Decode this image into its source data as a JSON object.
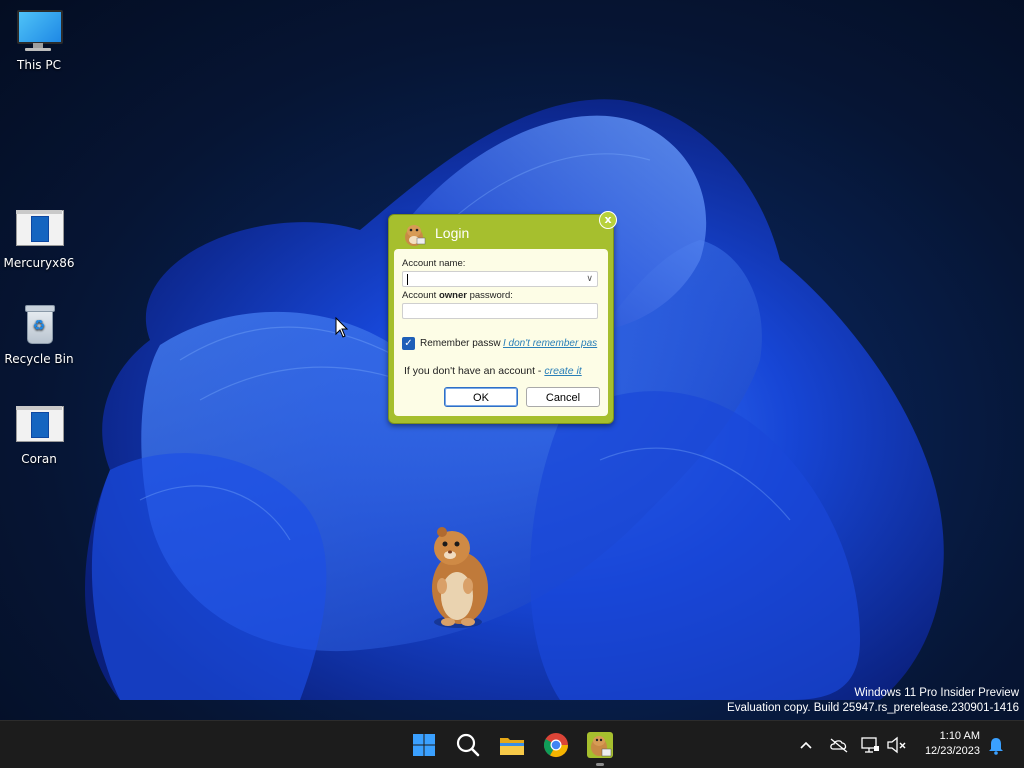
{
  "desktop": {
    "icons": [
      {
        "label": "This PC",
        "icon": "monitor-icon"
      },
      {
        "label": "Mercuryx86",
        "icon": "app-window-icon"
      },
      {
        "label": "Recycle Bin",
        "icon": "recycle-bin-icon"
      },
      {
        "label": "Coran",
        "icon": "app-window-icon"
      }
    ]
  },
  "login_dialog": {
    "title": "Login",
    "close_label": "x",
    "account_name_label": "Account name:",
    "account_name_value": "",
    "password_label_prefix": "Account ",
    "password_label_bold": "owner",
    "password_label_suffix": " password:",
    "password_value": "",
    "remember_label": "Remember passw",
    "remember_checked": true,
    "forgot_link": "I don't remember pas",
    "no_account_text": "If you don't have an account - ",
    "create_link": "create it",
    "ok_label": "OK",
    "cancel_label": "Cancel",
    "accent_color": "#a6bf2e"
  },
  "watermark": {
    "line1": "Windows 11 Pro Insider Preview",
    "line2": "Evaluation copy. Build 25947.rs_prerelease.230901-1416"
  },
  "taskbar": {
    "apps": [
      "windows-start-icon",
      "search-icon",
      "file-explorer-icon",
      "chrome-icon",
      "hamster-app-icon"
    ],
    "tray": [
      "chevron-up-icon",
      "cloud-offline-icon",
      "network-icon",
      "volume-mute-icon",
      "notification-bell-icon"
    ],
    "time": "1:10 AM",
    "date": "12/23/2023"
  }
}
